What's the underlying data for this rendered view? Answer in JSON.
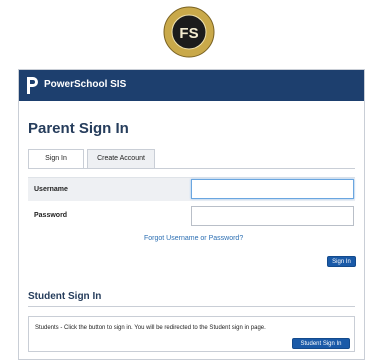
{
  "logo": {
    "text": "FS",
    "ring_text": "FLORENCE SCHOOL DISTRICT"
  },
  "brand": {
    "name": "PowerSchool SIS"
  },
  "page": {
    "title": "Parent Sign In"
  },
  "tabs": [
    {
      "label": "Sign In",
      "active": true
    },
    {
      "label": "Create Account",
      "active": false
    }
  ],
  "form": {
    "username_label": "Username",
    "username_value": "",
    "password_label": "Password",
    "password_value": "",
    "forgot_link": "Forgot Username or Password?",
    "sign_in_button": "Sign In"
  },
  "student": {
    "title": "Student Sign In",
    "message": "Students - Click the button to sign in. You will be redirected to the Student sign in page.",
    "button": "Student Sign In"
  },
  "colors": {
    "brand_bar": "#1d3f6e",
    "button": "#1a5aa8",
    "link": "#2c6fb3",
    "title": "#263d5c"
  }
}
